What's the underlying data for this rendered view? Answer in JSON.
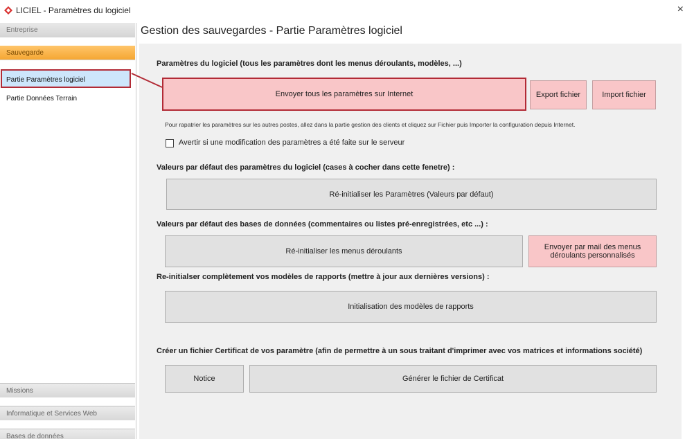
{
  "window": {
    "title": "LICIEL - Paramètres du logiciel",
    "close_label": "×"
  },
  "sidebar": {
    "entreprise": "Entreprise",
    "sauvegarde": "Sauvegarde",
    "items": [
      {
        "label": "Partie Paramètres logiciel",
        "selected": true
      },
      {
        "label": "Partie Données Terrain",
        "selected": false
      }
    ],
    "bottom": [
      "Missions",
      "Informatique et Services Web",
      "Bases de données"
    ]
  },
  "main": {
    "title": "Gestion des sauvegardes - Partie Paramètres logiciel",
    "section1": {
      "heading": "Paramètres du logiciel (tous les paramètres dont les menus déroulants, modèles, ...)",
      "send_button": "Envoyer tous les paramètres sur Internet",
      "export_button": "Export fichier",
      "import_button": "Import fichier",
      "hint": "Pour rapatrier les paramètres sur les autres postes, allez dans la partie gestion des clients et cliquez sur Fichier puis Importer la configuration depuis Internet.",
      "checkbox_label": "Avertir si une modification des paramètres a été faite sur le serveur",
      "checkbox_checked": false
    },
    "section2": {
      "heading": "Valeurs par défaut des paramètres du logiciel (cases à cocher dans cette fenetre) :",
      "reset_button": "Ré-initialiser les Paramètres (Valeurs par défaut)"
    },
    "section3": {
      "heading": "Valeurs par défaut des bases de données (commentaires ou listes pré-enregistrées, etc ...) :",
      "reset_menus_button": "Ré-initialiser les menus déroulants",
      "send_mail_button_line1": "Envoyer par mail des menus",
      "send_mail_button_line2": "déroulants personnalisés"
    },
    "section4": {
      "heading": "Re-initialser complètement vos modèles de rapports (mettre à jour aux dernières versions) :",
      "init_button": "Initialisation des modèles de rapports"
    },
    "section5": {
      "heading": "Créer un fichier Certificat de vos paramètre (afin de permettre à un sous traitant d'imprimer avec vos matrices et informations société)",
      "notice_button": "Notice",
      "generate_button": "Générer le fichier de Certificat"
    }
  },
  "colors": {
    "accent_red": "#b22b36",
    "pink_button": "#f9c6c8",
    "orange_section": "#f5a733",
    "selected_blue": "#cde6fb"
  }
}
